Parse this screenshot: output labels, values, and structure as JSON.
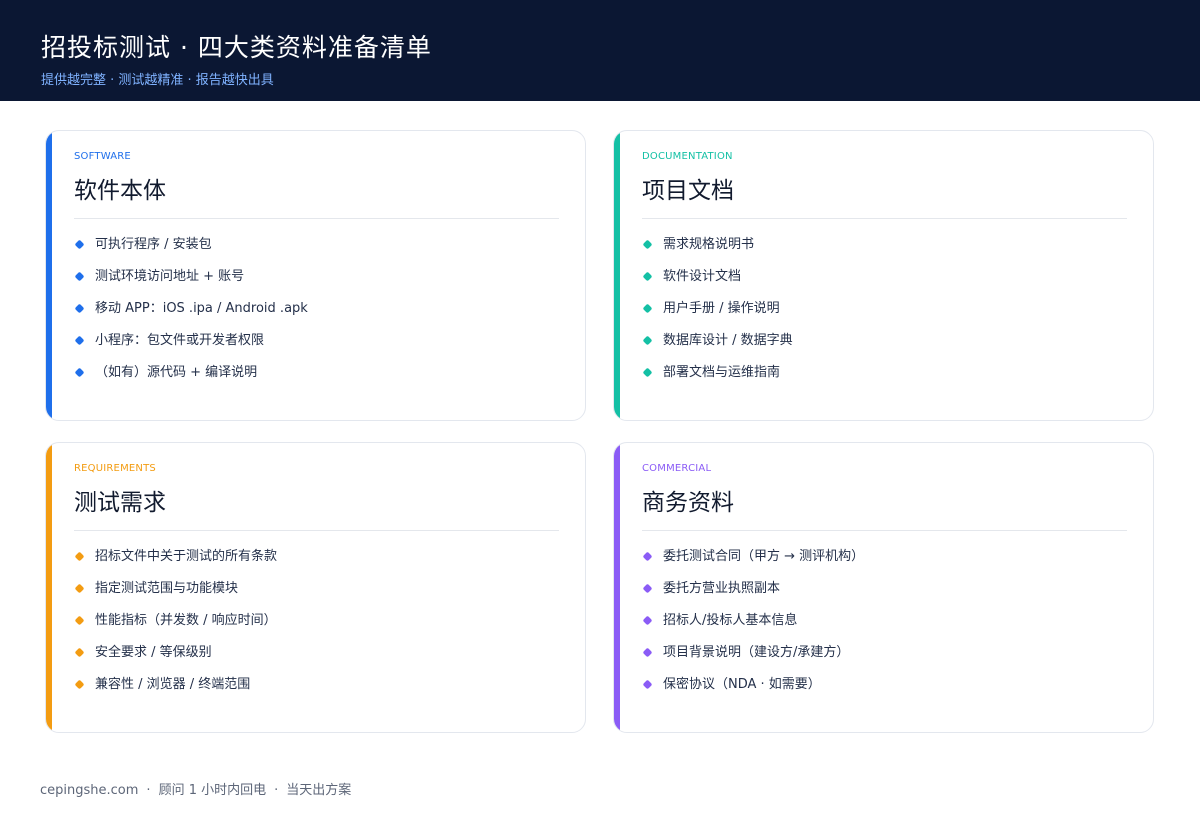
{
  "header": {
    "title": "招投标测试 ·  四大类资料准备清单",
    "subtitle": "提供越完整 ·  测试越精准 ·  报告越快出具",
    "bg_color": "#0b1733",
    "subtitle_color": "#7fb2ff"
  },
  "cards": [
    {
      "tag": "SOFTWARE",
      "title": "软件本体",
      "accent": "#1f6feb",
      "items": [
        "可执行程序 / 安装包",
        "测试环境访问地址 + 账号",
        "移动 APP：iOS .ipa / Android .apk",
        "小程序：包文件或开发者权限",
        "（如有）源代码 + 编译说明"
      ]
    },
    {
      "tag": "DOCUMENTATION",
      "title": "项目文档",
      "accent": "#14c0a5",
      "items": [
        "需求规格说明书",
        "软件设计文档",
        "用户手册 / 操作说明",
        "数据库设计 / 数据字典",
        "部署文档与运维指南"
      ]
    },
    {
      "tag": "REQUIREMENTS",
      "title": "测试需求",
      "accent": "#f39c12",
      "items": [
        "招标文件中关于测试的所有条款",
        "指定测试范围与功能模块",
        "性能指标（并发数 / 响应时间）",
        "安全要求 / 等保级别",
        "兼容性 / 浏览器 / 终端范围"
      ]
    },
    {
      "tag": "COMMERCIAL",
      "title": "商务资料",
      "accent": "#8b5cf6",
      "items": [
        "委托测试合同（甲方 → 测评机构）",
        "委托方营业执照副本",
        "招标人/投标人基本信息",
        "项目背景说明（建设方/承建方）",
        "保密协议（NDA ·  如需要）"
      ]
    }
  ],
  "footer": {
    "site": "cepingshe.com",
    "note1": "顾问 1 小时内回电",
    "note2": "当天出方案"
  }
}
